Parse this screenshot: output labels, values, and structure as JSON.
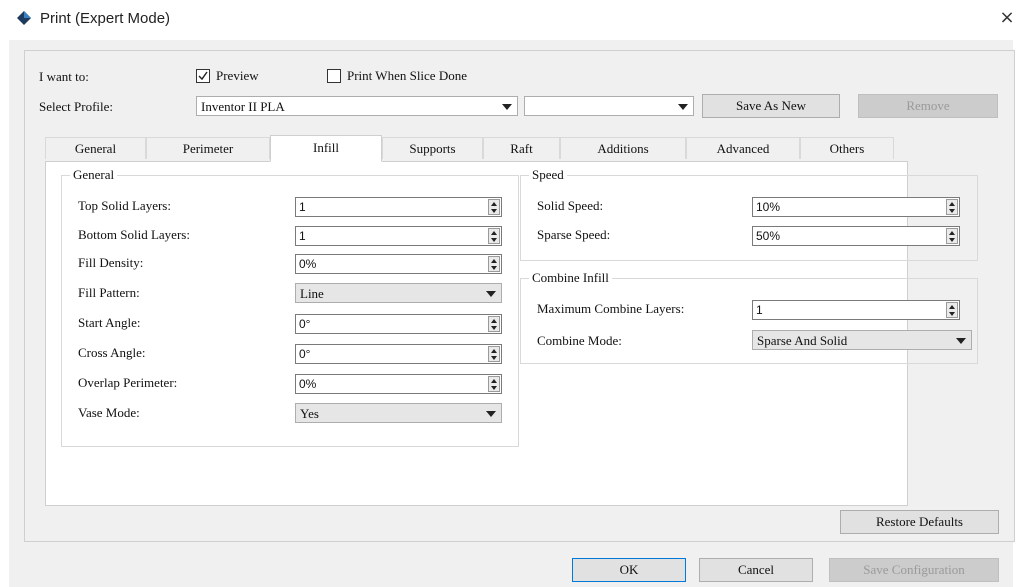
{
  "window": {
    "title": "Print (Expert Mode)",
    "close_glyph": "×",
    "icon": "diamond-app-icon"
  },
  "top": {
    "i_want_label": "I want to:",
    "preview_label": "Preview",
    "preview_checked": true,
    "print_when_done_label": "Print When Slice Done",
    "print_when_done_checked": false,
    "select_profile_label": "Select Profile:",
    "profile_value": "Inventor II PLA",
    "profile2_value": "",
    "save_as_new_label": "Save As New",
    "remove_label": "Remove"
  },
  "tabs": [
    {
      "label": "General"
    },
    {
      "label": "Perimeter"
    },
    {
      "label": "Infill",
      "active": true
    },
    {
      "label": "Supports"
    },
    {
      "label": "Raft"
    },
    {
      "label": "Additions"
    },
    {
      "label": "Advanced"
    },
    {
      "label": "Others"
    }
  ],
  "infill": {
    "general_title": "General",
    "general": [
      {
        "label": "Top Solid Layers:",
        "value": "1",
        "kind": "spin"
      },
      {
        "label": "Bottom Solid Layers:",
        "value": "1",
        "kind": "spin"
      },
      {
        "label": "Fill Density:",
        "value": "0%",
        "kind": "spin"
      },
      {
        "label": "Fill Pattern:",
        "value": "Line",
        "kind": "combo"
      },
      {
        "label": "Start Angle:",
        "value": "0°",
        "kind": "spin"
      },
      {
        "label": "Cross Angle:",
        "value": "0°",
        "kind": "spin"
      },
      {
        "label": "Overlap Perimeter:",
        "value": "0%",
        "kind": "spin"
      },
      {
        "label": "Vase Mode:",
        "value": "Yes",
        "kind": "combo"
      }
    ],
    "speed_title": "Speed",
    "speed": [
      {
        "label": "Solid Speed:",
        "value": "10%"
      },
      {
        "label": "Sparse Speed:",
        "value": "50%"
      }
    ],
    "combine_title": "Combine Infill",
    "max_combine_label": "Maximum Combine Layers:",
    "max_combine_value": "1",
    "combine_mode_label": "Combine Mode:",
    "combine_mode_value": "Sparse And Solid"
  },
  "buttons": {
    "restore_defaults": "Restore Defaults",
    "ok": "OK",
    "cancel": "Cancel",
    "save_configuration": "Save Configuration"
  }
}
